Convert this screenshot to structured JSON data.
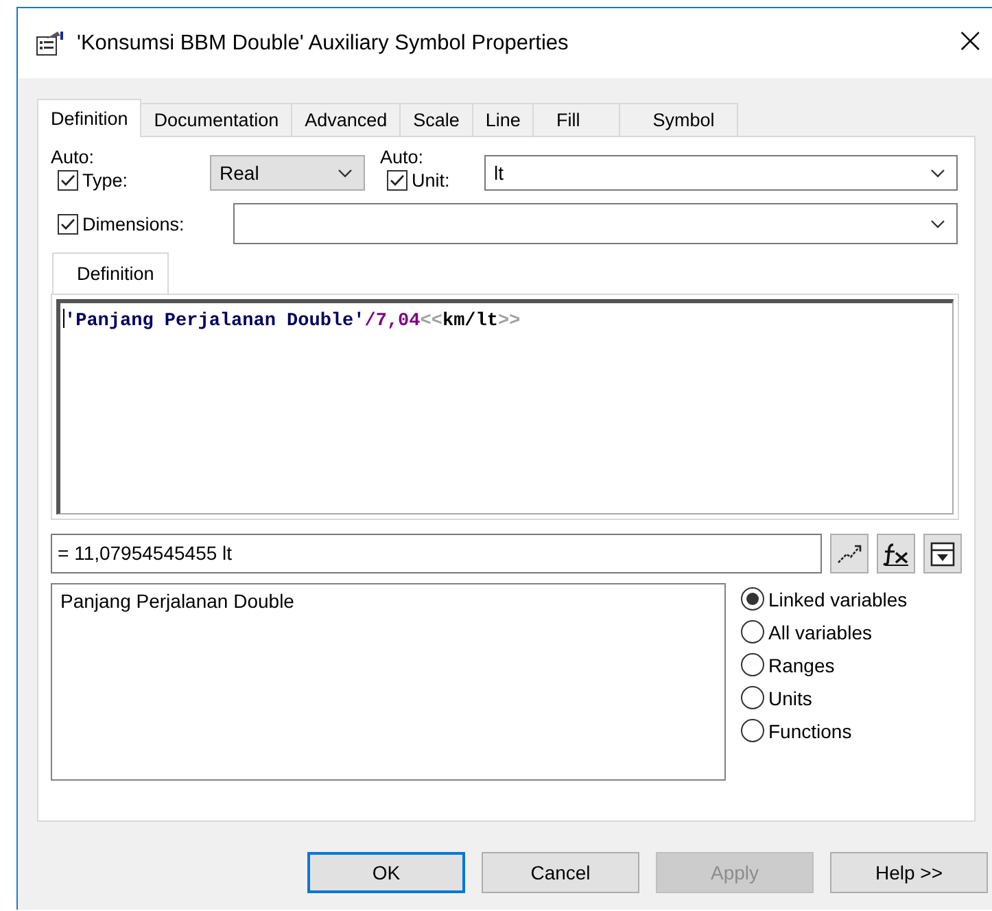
{
  "window": {
    "title": "'Konsumsi BBM Double' Auxiliary Symbol Properties",
    "close": "×"
  },
  "tabs": [
    {
      "label": "Definition",
      "selected": true
    },
    {
      "label": "Documentation",
      "selected": false
    },
    {
      "label": "Advanced",
      "selected": false
    },
    {
      "label": "Scale",
      "selected": false
    },
    {
      "label": "Line",
      "selected": false
    },
    {
      "label": "Fill",
      "selected": false
    },
    {
      "label": "Symbol",
      "selected": false
    }
  ],
  "type_auto_label": "Auto:",
  "type_check": {
    "label": "Type:",
    "checked": true
  },
  "type_combo": {
    "value": "Real"
  },
  "unit_auto_label": "Auto:",
  "unit_check": {
    "label": "Unit:",
    "checked": true
  },
  "unit_combo": {
    "value": "lt"
  },
  "dimensions_check": {
    "label": "Dimensions:",
    "checked": true
  },
  "inner_tab": {
    "label": "Definition"
  },
  "equation": [
    {
      "kind": "name",
      "text": "'Panjang Perjalanan Double'"
    },
    {
      "kind": "operator",
      "text": "/"
    },
    {
      "kind": "number",
      "text": "7,04"
    },
    {
      "kind": "bracket",
      "text": "<<"
    },
    {
      "kind": "unit",
      "text": "km/lt"
    },
    {
      "kind": "bracket",
      "text": ">>"
    }
  ],
  "result": {
    "value": "= 11,07954545455 lt"
  },
  "variables": [
    "Panjang Perjalanan Double"
  ],
  "list_options": [
    {
      "label": "Linked variables",
      "selected": true
    },
    {
      "label": "All variables",
      "selected": false
    },
    {
      "label": "Ranges",
      "selected": false
    },
    {
      "label": "Units",
      "selected": false
    },
    {
      "label": "Functions",
      "selected": false
    }
  ],
  "buttons": [
    {
      "label": "OK",
      "default": true,
      "disabled": false
    },
    {
      "label": "Cancel",
      "default": false,
      "disabled": false
    },
    {
      "label": "Apply",
      "default": false,
      "disabled": true
    },
    {
      "label": "Help >>",
      "default": false,
      "disabled": false
    }
  ]
}
